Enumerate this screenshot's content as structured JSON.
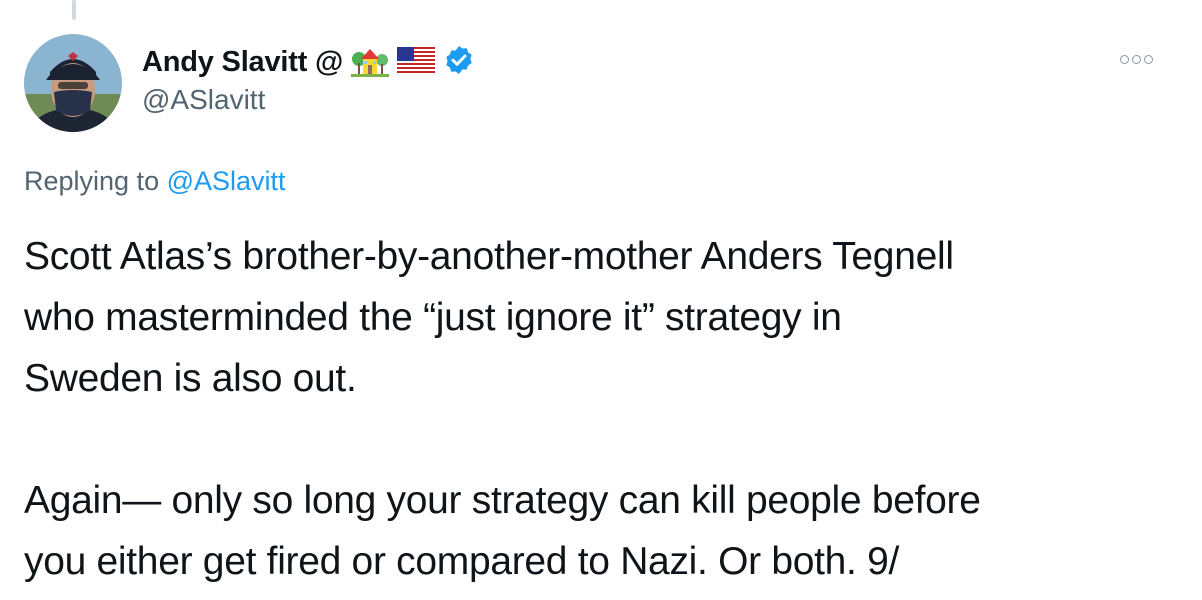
{
  "tweet": {
    "author_name": "Andy Slavitt @",
    "handle": "@ASlavitt",
    "replying_prefix": "Replying to ",
    "replying_handle": "@ASlavitt",
    "text": "Scott Atlas’s brother-by-another-mother Anders Tegnell\nwho masterminded the “just ignore it” strategy in\nSweden is also out.\n\nAgain— only so long your strategy can kill people before\nyou either get fired or compared to Nazi. Or both. 9/"
  },
  "icons": {
    "name_emojis": [
      "house-with-garden-icon",
      "us-flag-icon"
    ],
    "verified": "verified-badge-icon",
    "more": "more-options-icon"
  },
  "colors": {
    "link": "#1d9bf0",
    "secondary_text": "#536471",
    "verified": "#1d9bf0"
  }
}
